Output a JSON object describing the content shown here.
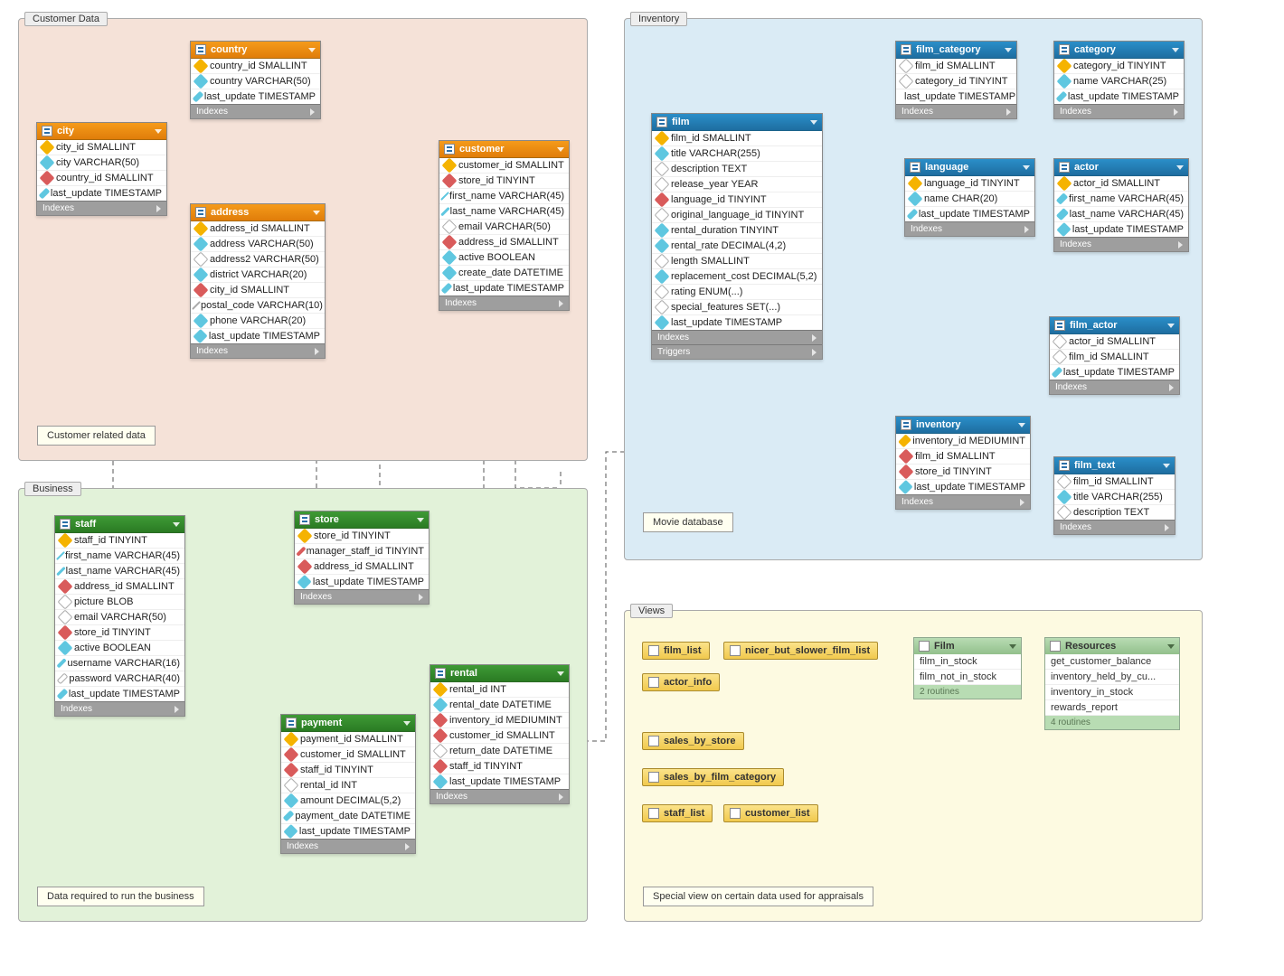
{
  "regions": {
    "customer": {
      "label": "Customer Data",
      "caption": "Customer related data"
    },
    "business": {
      "label": "Business",
      "caption": "Data required to run the business"
    },
    "inventory": {
      "label": "Inventory",
      "caption": "Movie database"
    },
    "views": {
      "label": "Views",
      "caption": "Special view on certain data used for appraisals"
    }
  },
  "footers": {
    "indexes": "Indexes",
    "triggers": "Triggers"
  },
  "tables": {
    "country": {
      "title": "country",
      "cols": [
        {
          "m": "key",
          "t": "country_id SMALLINT"
        },
        {
          "m": "blue",
          "t": "country VARCHAR(50)"
        },
        {
          "m": "blue",
          "t": "last_update TIMESTAMP"
        }
      ]
    },
    "city": {
      "title": "city",
      "cols": [
        {
          "m": "key",
          "t": "city_id SMALLINT"
        },
        {
          "m": "blue",
          "t": "city VARCHAR(50)"
        },
        {
          "m": "red",
          "t": "country_id SMALLINT"
        },
        {
          "m": "blue",
          "t": "last_update TIMESTAMP"
        }
      ]
    },
    "address": {
      "title": "address",
      "cols": [
        {
          "m": "key",
          "t": "address_id SMALLINT"
        },
        {
          "m": "blue",
          "t": "address VARCHAR(50)"
        },
        {
          "m": "open",
          "t": "address2 VARCHAR(50)"
        },
        {
          "m": "blue",
          "t": "district VARCHAR(20)"
        },
        {
          "m": "red",
          "t": "city_id SMALLINT"
        },
        {
          "m": "open",
          "t": "postal_code VARCHAR(10)"
        },
        {
          "m": "blue",
          "t": "phone VARCHAR(20)"
        },
        {
          "m": "blue",
          "t": "last_update TIMESTAMP"
        }
      ]
    },
    "customer": {
      "title": "customer",
      "cols": [
        {
          "m": "key",
          "t": "customer_id SMALLINT"
        },
        {
          "m": "red",
          "t": "store_id TINYINT"
        },
        {
          "m": "blue",
          "t": "first_name VARCHAR(45)"
        },
        {
          "m": "blue",
          "t": "last_name VARCHAR(45)"
        },
        {
          "m": "open",
          "t": "email VARCHAR(50)"
        },
        {
          "m": "red",
          "t": "address_id SMALLINT"
        },
        {
          "m": "blue",
          "t": "active BOOLEAN"
        },
        {
          "m": "blue",
          "t": "create_date DATETIME"
        },
        {
          "m": "blue",
          "t": "last_update TIMESTAMP"
        }
      ]
    },
    "staff": {
      "title": "staff",
      "cols": [
        {
          "m": "key",
          "t": "staff_id TINYINT"
        },
        {
          "m": "blue",
          "t": "first_name VARCHAR(45)"
        },
        {
          "m": "blue",
          "t": "last_name VARCHAR(45)"
        },
        {
          "m": "red",
          "t": "address_id SMALLINT"
        },
        {
          "m": "open",
          "t": "picture BLOB"
        },
        {
          "m": "open",
          "t": "email VARCHAR(50)"
        },
        {
          "m": "red",
          "t": "store_id TINYINT"
        },
        {
          "m": "blue",
          "t": "active BOOLEAN"
        },
        {
          "m": "blue",
          "t": "username VARCHAR(16)"
        },
        {
          "m": "open",
          "t": "password VARCHAR(40)"
        },
        {
          "m": "blue",
          "t": "last_update TIMESTAMP"
        }
      ]
    },
    "store": {
      "title": "store",
      "cols": [
        {
          "m": "key",
          "t": "store_id TINYINT"
        },
        {
          "m": "red",
          "t": "manager_staff_id TINYINT"
        },
        {
          "m": "red",
          "t": "address_id SMALLINT"
        },
        {
          "m": "blue",
          "t": "last_update TIMESTAMP"
        }
      ]
    },
    "payment": {
      "title": "payment",
      "cols": [
        {
          "m": "key",
          "t": "payment_id SMALLINT"
        },
        {
          "m": "red",
          "t": "customer_id SMALLINT"
        },
        {
          "m": "red",
          "t": "staff_id TINYINT"
        },
        {
          "m": "open",
          "t": "rental_id INT"
        },
        {
          "m": "blue",
          "t": "amount DECIMAL(5,2)"
        },
        {
          "m": "blue",
          "t": "payment_date DATETIME"
        },
        {
          "m": "blue",
          "t": "last_update TIMESTAMP"
        }
      ]
    },
    "rental": {
      "title": "rental",
      "cols": [
        {
          "m": "key",
          "t": "rental_id INT"
        },
        {
          "m": "blue",
          "t": "rental_date DATETIME"
        },
        {
          "m": "red",
          "t": "inventory_id MEDIUMINT"
        },
        {
          "m": "red",
          "t": "customer_id SMALLINT"
        },
        {
          "m": "open",
          "t": "return_date DATETIME"
        },
        {
          "m": "red",
          "t": "staff_id TINYINT"
        },
        {
          "m": "blue",
          "t": "last_update TIMESTAMP"
        }
      ]
    },
    "film": {
      "title": "film",
      "triggers": true,
      "cols": [
        {
          "m": "key",
          "t": "film_id SMALLINT"
        },
        {
          "m": "blue",
          "t": "title VARCHAR(255)"
        },
        {
          "m": "open",
          "t": "description TEXT"
        },
        {
          "m": "open",
          "t": "release_year YEAR"
        },
        {
          "m": "red",
          "t": "language_id TINYINT"
        },
        {
          "m": "open",
          "t": "original_language_id TINYINT"
        },
        {
          "m": "blue",
          "t": "rental_duration TINYINT"
        },
        {
          "m": "blue",
          "t": "rental_rate DECIMAL(4,2)"
        },
        {
          "m": "open",
          "t": "length SMALLINT"
        },
        {
          "m": "blue",
          "t": "replacement_cost DECIMAL(5,2)"
        },
        {
          "m": "open",
          "t": "rating ENUM(...)"
        },
        {
          "m": "open",
          "t": "special_features SET(...)"
        },
        {
          "m": "blue",
          "t": "last_update TIMESTAMP"
        }
      ]
    },
    "film_category": {
      "title": "film_category",
      "cols": [
        {
          "m": "",
          "t": "film_id SMALLINT"
        },
        {
          "m": "",
          "t": "category_id TINYINT"
        },
        {
          "m": "blue",
          "t": "last_update TIMESTAMP"
        }
      ]
    },
    "category": {
      "title": "category",
      "cols": [
        {
          "m": "key",
          "t": "category_id TINYINT"
        },
        {
          "m": "blue",
          "t": "name VARCHAR(25)"
        },
        {
          "m": "blue",
          "t": "last_update TIMESTAMP"
        }
      ]
    },
    "language": {
      "title": "language",
      "cols": [
        {
          "m": "key",
          "t": "language_id TINYINT"
        },
        {
          "m": "blue",
          "t": "name CHAR(20)"
        },
        {
          "m": "blue",
          "t": "last_update TIMESTAMP"
        }
      ]
    },
    "actor": {
      "title": "actor",
      "cols": [
        {
          "m": "key",
          "t": "actor_id SMALLINT"
        },
        {
          "m": "blue",
          "t": "first_name VARCHAR(45)"
        },
        {
          "m": "blue",
          "t": "last_name VARCHAR(45)"
        },
        {
          "m": "blue",
          "t": "last_update TIMESTAMP"
        }
      ]
    },
    "film_actor": {
      "title": "film_actor",
      "cols": [
        {
          "m": "",
          "t": "actor_id SMALLINT"
        },
        {
          "m": "",
          "t": "film_id SMALLINT"
        },
        {
          "m": "blue",
          "t": "last_update TIMESTAMP"
        }
      ]
    },
    "inventory": {
      "title": "inventory",
      "cols": [
        {
          "m": "key",
          "t": "inventory_id MEDIUMINT"
        },
        {
          "m": "red",
          "t": "film_id SMALLINT"
        },
        {
          "m": "red",
          "t": "store_id TINYINT"
        },
        {
          "m": "blue",
          "t": "last_update TIMESTAMP"
        }
      ]
    },
    "film_text": {
      "title": "film_text",
      "cols": [
        {
          "m": "",
          "t": "film_id SMALLINT"
        },
        {
          "m": "blue",
          "t": "title VARCHAR(255)"
        },
        {
          "m": "open",
          "t": "description TEXT"
        }
      ]
    }
  },
  "views": {
    "items": [
      "film_list",
      "nicer_but_slower_film_list",
      "actor_info",
      "sales_by_store",
      "sales_by_film_category",
      "staff_list",
      "customer_list"
    ]
  },
  "routines": {
    "film": {
      "title": "Film",
      "rows": [
        "film_in_stock",
        "film_not_in_stock"
      ],
      "footer": "2 routines"
    },
    "resources": {
      "title": "Resources",
      "rows": [
        "get_customer_balance",
        "inventory_held_by_cu...",
        "inventory_in_stock",
        "rewards_report"
      ],
      "footer": "4 routines"
    }
  }
}
